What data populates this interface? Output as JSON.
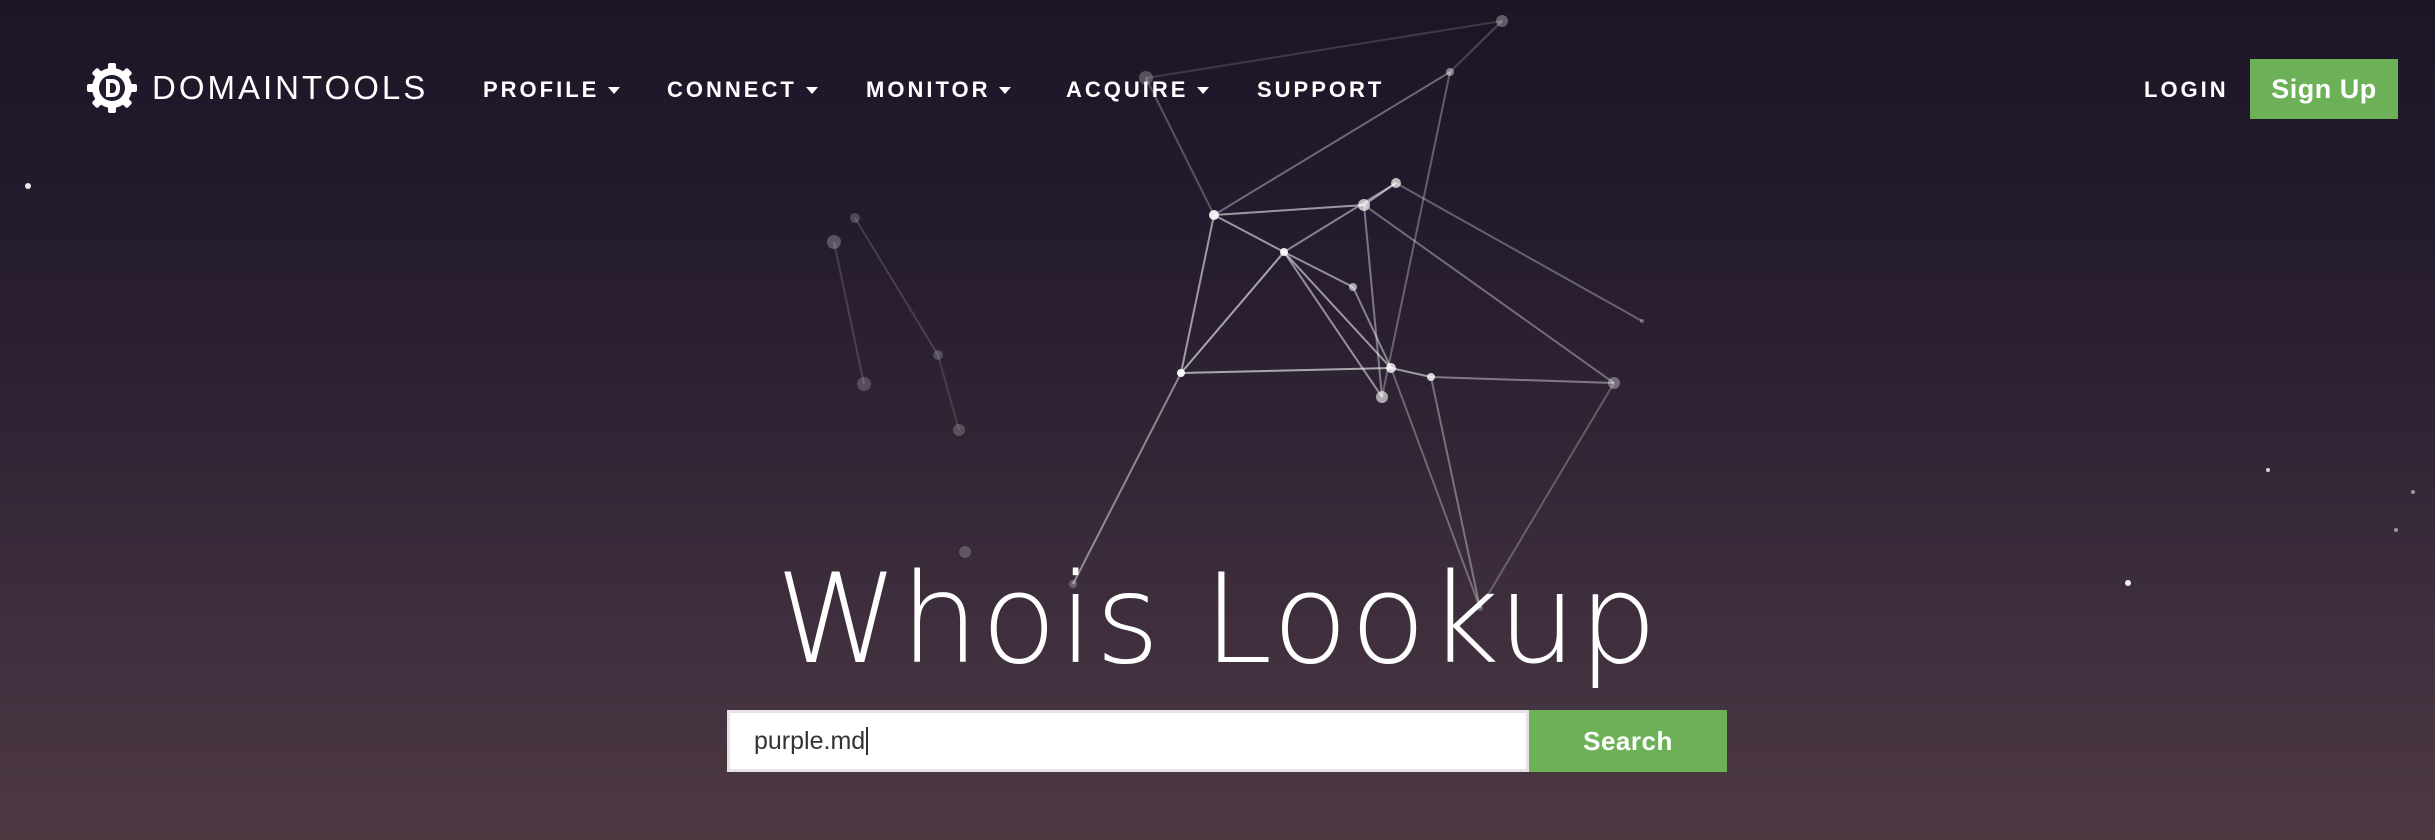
{
  "brand": {
    "name": "DOMAINTOOLS",
    "logo_icon": "gear-d-logo-icon"
  },
  "nav": {
    "items": [
      {
        "label": "PROFILE",
        "has_dropdown": true
      },
      {
        "label": "CONNECT",
        "has_dropdown": true
      },
      {
        "label": "MONITOR",
        "has_dropdown": true
      },
      {
        "label": "ACQUIRE",
        "has_dropdown": true
      },
      {
        "label": "SUPPORT",
        "has_dropdown": false
      }
    ],
    "login_label": "LOGIN",
    "signup_label": "Sign Up"
  },
  "hero": {
    "title": "Whois Lookup"
  },
  "search": {
    "value": "purple.md",
    "button_label": "Search"
  },
  "colors": {
    "accent_green": "#6cb158",
    "background_top": "#1d1526",
    "background_bottom": "#4d3942",
    "text": "#ffffff"
  }
}
